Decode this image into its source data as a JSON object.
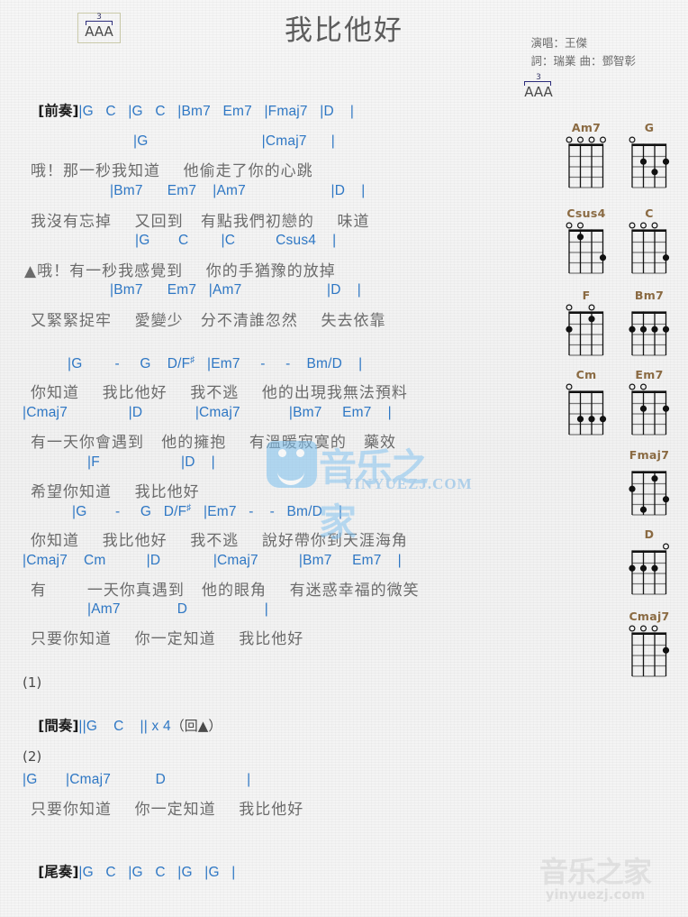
{
  "header": {
    "title": "我比他好",
    "singer_line": "演唱：王傑",
    "writer_line": "詞：瑞業  曲：鄧智彰",
    "strum_marker": {
      "triplet": "3",
      "pattern": "AAA",
      "name": "triplet-strum-marker"
    }
  },
  "sections": {
    "prelude": {
      "label": "[前奏]",
      "chords": "|G   C   |G   C   |Bm7   Em7   |Fmaj7   |D    |"
    },
    "verse1": {
      "lines": [
        {
          "chords": "|G                            |Cmaj7      |",
          "lyrics": "哦！那一秒我知道    他偷走了你的心跳"
        },
        {
          "chords": "|Bm7      Em7    |Am7                     |D    |",
          "lyrics": "我沒有忘掉    又回到   有點我們初戀的    味道"
        },
        {
          "chords": "|G       C        |C          Csus4    |",
          "lyrics": "▲哦！有一秒我感覺到    你的手猶豫的放掉"
        },
        {
          "chords": "|Bm7      Em7   |Am7                     |D    |",
          "lyrics": "又緊緊捉牢    愛變少   分不清誰忽然    失去依靠"
        }
      ]
    },
    "chorus1": {
      "lines": [
        {
          "chords": "|G        -     G    D/F#   |Em7     -     -    Bm/D    |",
          "lyrics": "你知道    我比他好    我不逃    他的出現我無法預料"
        },
        {
          "chords": "|Cmaj7               |D             |Cmaj7            |Bm7     Em7    |",
          "lyrics": "有一天你會遇到   他的擁抱    有溫暖寂寞的   藥效"
        },
        {
          "chords": "|F                    |D    |",
          "lyrics": "希望你知道    我比他好"
        }
      ]
    },
    "chorus2": {
      "lines": [
        {
          "chords": "|G       -     G   D/F#   |Em7   -    -   Bm/D    |",
          "lyrics": "你知道    我比他好    我不逃    說好帶你到天涯海角"
        },
        {
          "chords": "|Cmaj7    Cm          |D             |Cmaj7          |Bm7     Em7    |",
          "lyrics": "有       一天你真遇到   他的眼角    有迷惑幸福的微笑"
        },
        {
          "chords": "|Am7              D                   |",
          "lyrics": "只要你知道    你一定知道    我比他好"
        }
      ]
    },
    "interlude": {
      "number": "(1)",
      "label": "[間奏]",
      "chords": "||G    C    || x 4",
      "repeat_note": "（回▲）"
    },
    "ending_verse": {
      "number": "(2)",
      "chords": "|G       |Cmaj7           D                    |",
      "lyrics": "只要你知道    你一定知道    我比他好"
    },
    "outro": {
      "label": "[尾奏]",
      "chords": "|G   C   |G   C   |G   |G   |"
    }
  },
  "chord_diagrams": [
    {
      "name": "Am7",
      "open": [
        1,
        2,
        3,
        4
      ],
      "dots": []
    },
    {
      "name": "G",
      "open": [
        1
      ],
      "dots": [
        [
          2,
          2
        ],
        [
          4,
          2
        ],
        [
          3,
          3
        ]
      ]
    },
    {
      "name": "Csus4",
      "open": [
        1,
        2
      ],
      "dots": [
        [
          2,
          1
        ],
        [
          4,
          3
        ]
      ]
    },
    {
      "name": "C",
      "open": [
        1,
        2,
        3
      ],
      "dots": [
        [
          4,
          3
        ]
      ]
    },
    {
      "name": "F",
      "open": [
        1,
        3
      ],
      "dots": [
        [
          3,
          1
        ],
        [
          1,
          2
        ]
      ]
    },
    {
      "name": "Bm7",
      "open": [],
      "dots": [
        [
          1,
          2
        ],
        [
          2,
          2
        ],
        [
          3,
          2
        ],
        [
          4,
          2
        ]
      ]
    },
    {
      "name": "Cm",
      "open": [
        1
      ],
      "dots": [
        [
          2,
          3
        ],
        [
          3,
          3
        ],
        [
          4,
          3
        ]
      ]
    },
    {
      "name": "Em7",
      "open": [
        1,
        2
      ],
      "dots": [
        [
          2,
          2
        ],
        [
          4,
          2
        ]
      ]
    },
    {
      "name": "Fmaj7",
      "open": [],
      "dots": [
        [
          3,
          1
        ],
        [
          1,
          2
        ],
        [
          4,
          3
        ],
        [
          2,
          4
        ]
      ]
    },
    {
      "name": "D",
      "open": [
        4
      ],
      "dots": [
        [
          1,
          2
        ],
        [
          2,
          2
        ],
        [
          3,
          2
        ]
      ]
    },
    {
      "name": "Cmaj7",
      "open": [
        1,
        2,
        3
      ],
      "dots": [
        [
          4,
          2
        ]
      ]
    }
  ],
  "watermark": {
    "center_cn": "音乐之家",
    "center_en": "YINYUEZJ.COM",
    "bottom_cn": "音乐之家",
    "bottom_en": "yinyuezj.com"
  },
  "colors": {
    "chord_blue": "#2e77c4",
    "lyric_gray": "#6b6b6b",
    "chordname_brown": "#8a6a42",
    "background": "#f4f4f4"
  }
}
